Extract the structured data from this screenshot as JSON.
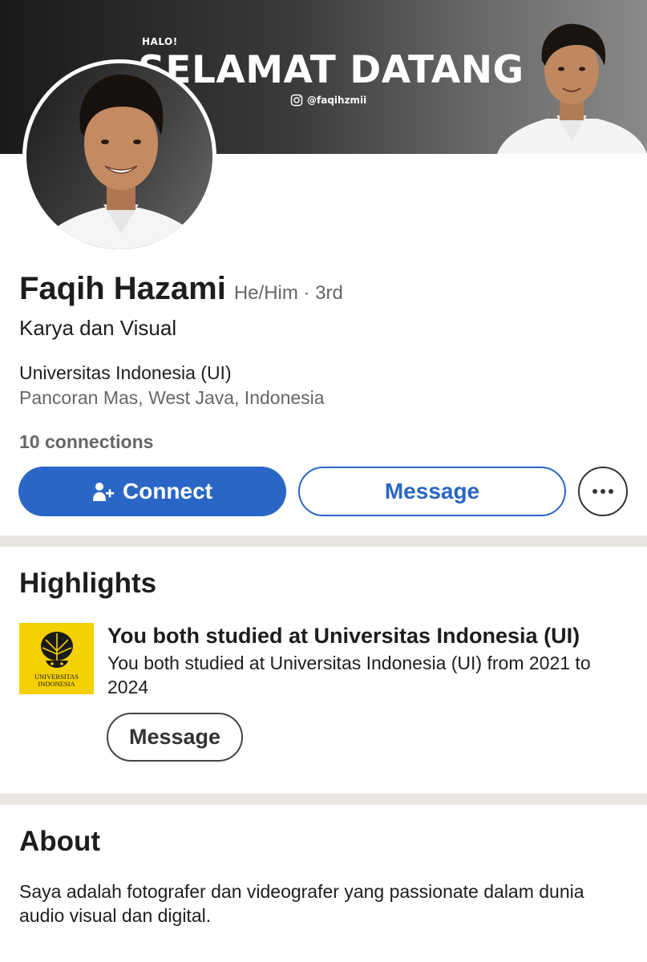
{
  "banner": {
    "greeting": "HALO!",
    "title": "SELAMAT DATANG",
    "instagram_handle": "@faqihzmii",
    "instagram_icon": "instagram-icon"
  },
  "profile": {
    "name": "Faqih Hazami",
    "pronouns_degree": "He/Him · 3rd",
    "headline": "Karya dan Visual",
    "school": "Universitas Indonesia (UI)",
    "location": "Pancoran Mas, West Java, Indonesia",
    "connections": "10 connections"
  },
  "actions": {
    "connect_label": "Connect",
    "connect_icon": "add-person-icon",
    "message_label": "Message",
    "more_icon": "more-options-icon"
  },
  "highlights": {
    "title": "Highlights",
    "logo_text_line1": "UNIVERSITAS",
    "logo_text_line2": "INDONESIA",
    "item_title": "You both studied at Universitas Indonesia (UI)",
    "item_desc": "You both studied at Universitas Indonesia (UI) from 2021 to 2024",
    "message_label": "Message"
  },
  "about": {
    "title": "About",
    "text": "Saya adalah fotografer dan videografer yang passionate dalam dunia audio visual dan digital."
  },
  "colors": {
    "primary": "#2a66c5",
    "divider": "#e9e6e1",
    "ui_yellow": "#f4d000"
  }
}
